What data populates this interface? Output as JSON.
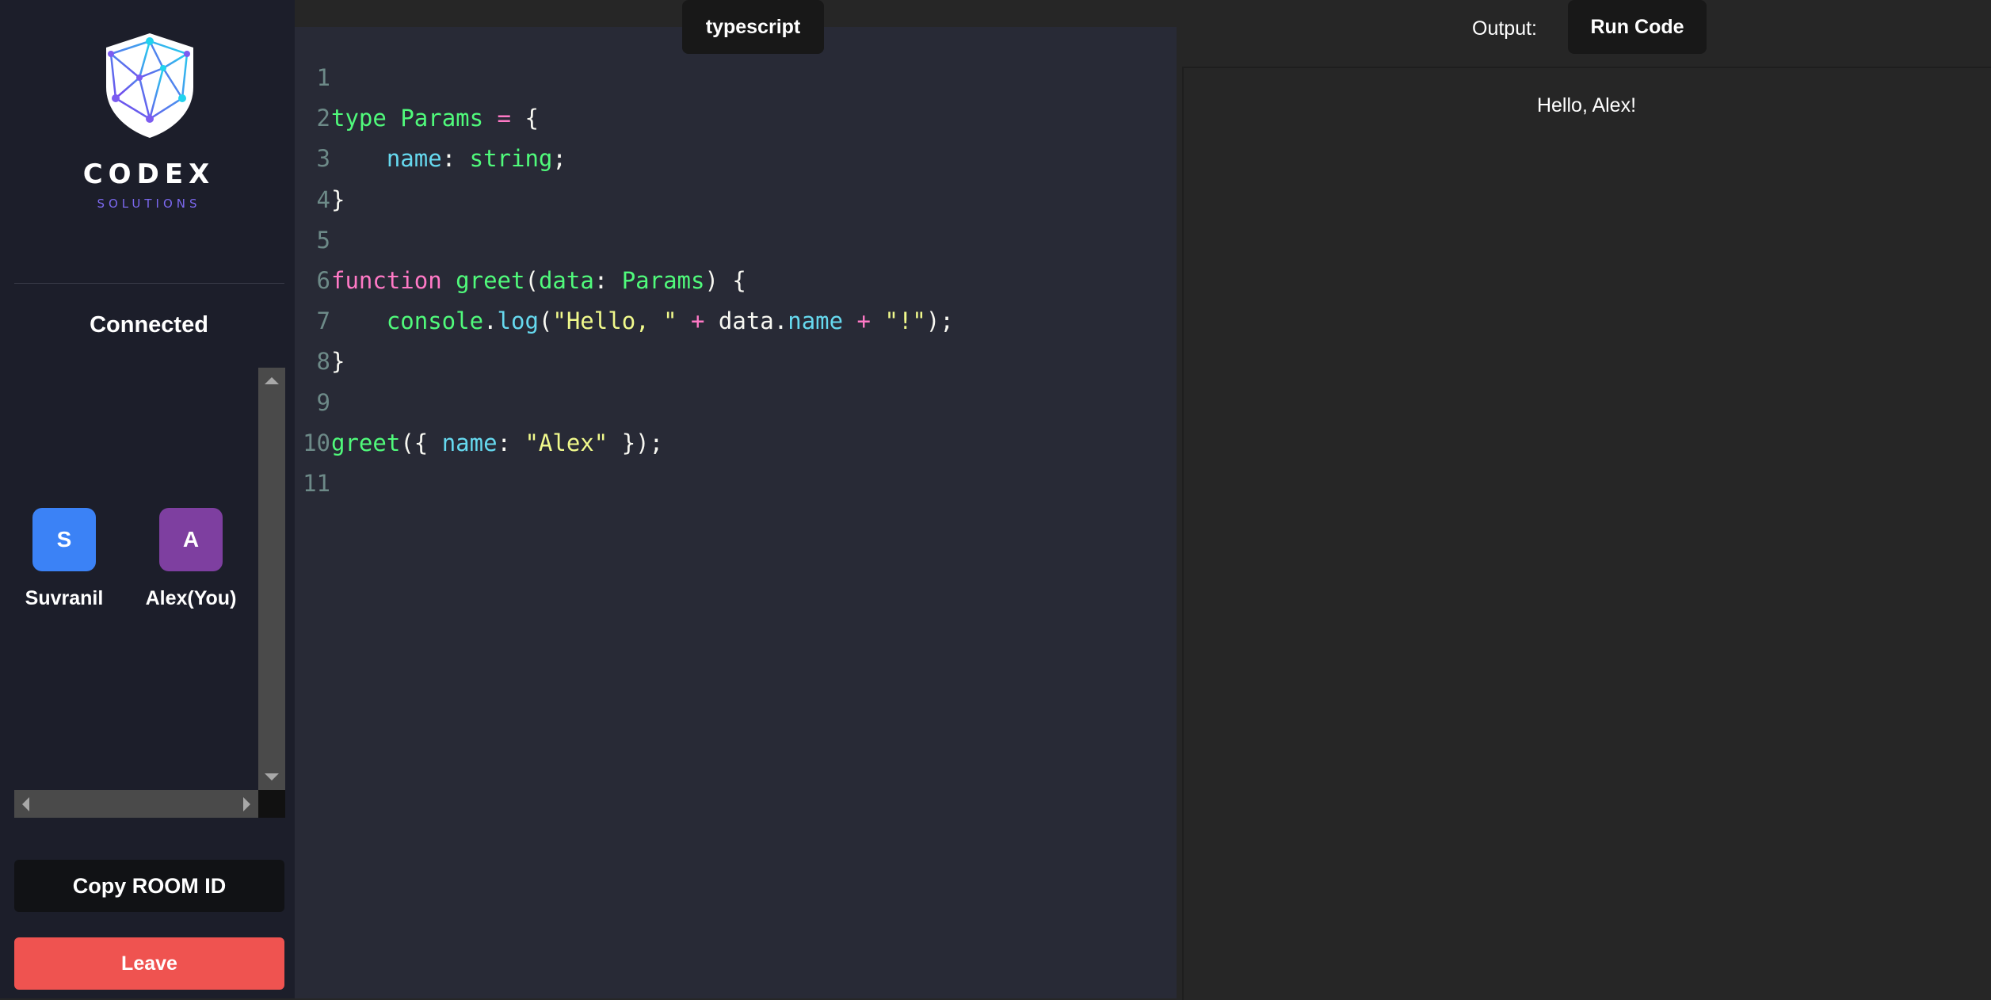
{
  "sidebar": {
    "brand": "CODEX",
    "brand_sub": "SOLUTIONS",
    "connected_title": "Connected",
    "clients": [
      {
        "initial": "S",
        "name": "Suvranil",
        "color": "#3b82f6"
      },
      {
        "initial": "A",
        "name": "Alex(You)",
        "color": "#7e3fa0"
      }
    ],
    "copy_button": "Copy ROOM ID",
    "leave_button": "Leave"
  },
  "editor": {
    "language": "typescript",
    "line_numbers": [
      "1",
      "2",
      "3",
      "4",
      "5",
      "6",
      "7",
      "8",
      "9",
      "10",
      "11"
    ],
    "code_lines": [
      "",
      "type Params = {",
      "    name: string;",
      "}",
      "",
      "function greet(data: Params) {",
      "    console.log(\"Hello, \" + data.name + \"!\");",
      "}",
      "",
      "greet({ name: \"Alex\" });",
      ""
    ]
  },
  "output": {
    "label": "Output:",
    "run_button": "Run Code",
    "text": "Hello, Alex!"
  },
  "colors": {
    "sidebar_bg": "#1c1e2a",
    "editor_bg": "#282a36",
    "leave": "#ef5350",
    "keyword": "#ff79c6",
    "type": "#50fa7b",
    "property": "#66d9ef",
    "string": "#f1fa8c",
    "brand_sub": "#7b68ee"
  }
}
